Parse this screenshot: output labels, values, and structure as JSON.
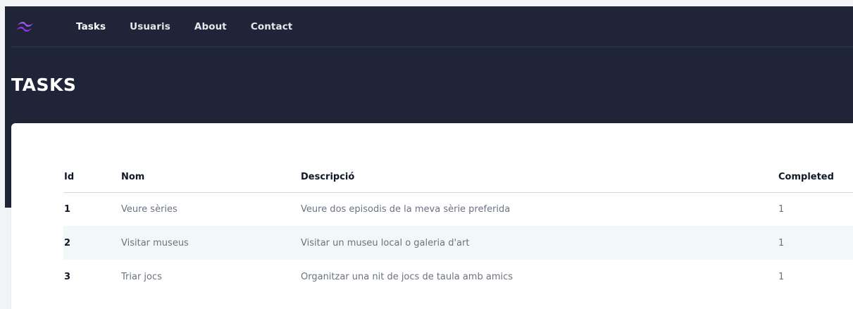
{
  "nav": {
    "logo_icon": "tailwind-logo-icon",
    "accent": "#a855f7",
    "links": [
      "Tasks",
      "Usuaris",
      "About",
      "Contact"
    ]
  },
  "header": {
    "title": "TASKS"
  },
  "table": {
    "columns": [
      "Id",
      "Nom",
      "Descripció",
      "Completed"
    ],
    "rows": [
      {
        "id": "1",
        "nom": "Veure sèries",
        "descripcio": "Veure dos episodis de la meva sèrie preferida",
        "completed": "1"
      },
      {
        "id": "2",
        "nom": "Visitar museus",
        "descripcio": "Visitar un museu local o galeria d'art",
        "completed": "1"
      },
      {
        "id": "3",
        "nom": "Triar jocs",
        "descripcio": "Organitzar una nit de jocs de taula amb amics",
        "completed": "1"
      }
    ]
  },
  "colors": {
    "header_bg": "#1f2438",
    "stripe": "#f2f8f8"
  }
}
